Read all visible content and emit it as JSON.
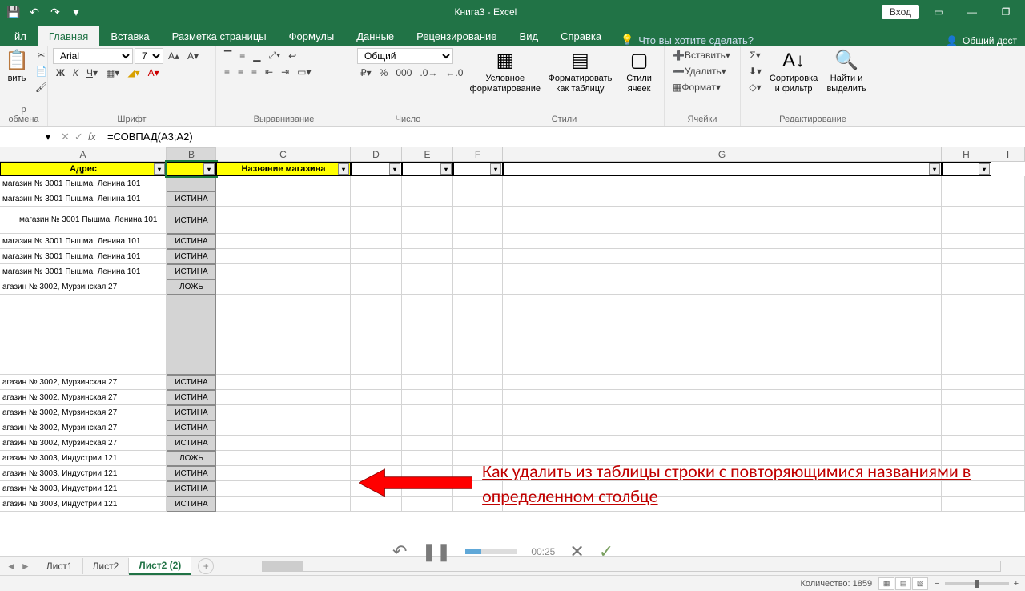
{
  "app": {
    "title": "Книга3 - Excel",
    "login": "Вход",
    "share": "Общий дост"
  },
  "qat": {
    "save": "💾",
    "undo": "↶",
    "redo": "↷",
    "more": "▾"
  },
  "tabs": {
    "file": "йл",
    "home": "Главная",
    "insert": "Вставка",
    "layout": "Разметка страницы",
    "formulas": "Формулы",
    "data": "Данные",
    "review": "Рецензирование",
    "view": "Вид",
    "help": "Справка",
    "tellme": "Что вы хотите сделать?"
  },
  "ribbon": {
    "clipboard": {
      "label": "р обмена",
      "paste": "вить"
    },
    "font": {
      "label": "Шрифт",
      "name": "Arial",
      "size": "7"
    },
    "align": {
      "label": "Выравнивание"
    },
    "number": {
      "label": "Число",
      "format": "Общий"
    },
    "styles": {
      "label": "Стили",
      "cond": "Условное форматирование",
      "table": "Форматировать как таблицу",
      "cell": "Стили ячеек"
    },
    "cells": {
      "label": "Ячейки",
      "ins": "Вставить",
      "del": "Удалить",
      "fmt": "Формат"
    },
    "edit": {
      "label": "Редактирование",
      "sort": "Сортировка и фильтр",
      "find": "Найти и выделить"
    }
  },
  "formula": {
    "namebox": "",
    "value": "=СОВПАД(A3;A2)"
  },
  "columns": [
    "A",
    "B",
    "C",
    "D",
    "E",
    "F",
    "G",
    "H",
    "I"
  ],
  "headers": {
    "A": "Адрес",
    "B": "",
    "C": "Название магазина",
    "D": "",
    "E": "",
    "F": "",
    "G": "",
    "H": ""
  },
  "rows": [
    {
      "a": "магазин № 3001 Пышма, Ленина 101",
      "b": ""
    },
    {
      "a": "магазин № 3001 Пышма, Ленина 101",
      "b": "ИСТИНА"
    },
    {
      "a": "магазин № 3001 Пышма, Ленина 101",
      "b": "ИСТИНА",
      "tall": true,
      "indent": true
    },
    {
      "a": "магазин № 3001 Пышма, Ленина 101",
      "b": "ИСТИНА"
    },
    {
      "a": "магазин № 3001 Пышма, Ленина 101",
      "b": "ИСТИНА"
    },
    {
      "a": "магазин № 3001 Пышма, Ленина 101",
      "b": "ИСТИНА"
    },
    {
      "a": "агазин № 3002, Мурзинская 27",
      "b": "ЛОЖЬ"
    },
    {
      "a": "",
      "b": "",
      "big": true
    },
    {
      "a": "агазин № 3002, Мурзинская 27",
      "b": "ИСТИНА"
    },
    {
      "a": "агазин № 3002, Мурзинская 27",
      "b": "ИСТИНА"
    },
    {
      "a": "агазин № 3002, Мурзинская 27",
      "b": "ИСТИНА"
    },
    {
      "a": "агазин № 3002, Мурзинская 27",
      "b": "ИСТИНА"
    },
    {
      "a": "агазин № 3002, Мурзинская 27",
      "b": "ИСТИНА"
    },
    {
      "a": "агазин № 3003, Индустрии 121",
      "b": "ЛОЖЬ"
    },
    {
      "a": "агазин № 3003, Индустрии 121",
      "b": "ИСТИНА"
    },
    {
      "a": "агазин № 3003, Индустрии 121",
      "b": "ИСТИНА"
    },
    {
      "a": "агазин № 3003, Индустрии 121",
      "b": "ИСТИНА"
    }
  ],
  "annotation": "Как удалить из таблицы строки с повторяющимися названиями в определенном столбце",
  "sheets": {
    "s1": "Лист1",
    "s2": "Лист2",
    "s3": "Лист2 (2)"
  },
  "player": {
    "time": "00:25"
  },
  "status": {
    "count": "Количество: 1859",
    "zoom": ""
  }
}
